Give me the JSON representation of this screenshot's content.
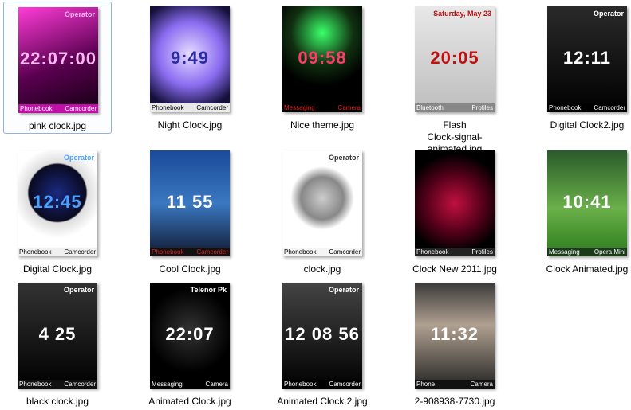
{
  "items": [
    {
      "label": "pink clock.jpg",
      "selected": true,
      "bg": "linear-gradient(160deg,#ff3cd8,#5a0050 55%,#120010)",
      "fg": "#ffb6f4",
      "op": "Operator",
      "time": "22:07:00",
      "left": "Phonebook",
      "right": "Camcorder",
      "keybg": "#c010a8"
    },
    {
      "label": "Night Clock.jpg",
      "bg": "radial-gradient(circle at 50% 45%,#e6dcff,#8a6cf0 45%,#14103a 80%)",
      "fg": "#2a2aa0",
      "op": "",
      "time": "9:49",
      "left": "Phonebook",
      "right": "Camcorder",
      "keybg": "#e8e8e8"
    },
    {
      "label": "Nice theme.jpg",
      "bg": "radial-gradient(circle at 50% 25%,#3cff6a,#103010 35%,#000 60%)",
      "fg": "#ff3c6a",
      "op": "",
      "time": "09:58",
      "left": "Messaging",
      "right": "Camera",
      "keybg": "#000",
      "keyfg": "#e02020"
    },
    {
      "label": "Flash\nClock-signal-animated.jpg",
      "bg": "linear-gradient(180deg,#e8e8e8,#bdbdbd)",
      "fg": "#c01010",
      "op": "Saturday, May 23",
      "time": "20:05",
      "left": "Bluetooth",
      "right": "Profiles",
      "keybg": "#888"
    },
    {
      "label": "Digital Clock2.jpg",
      "bg": "linear-gradient(180deg,#2a2a2a,#000)",
      "fg": "#fff",
      "op": "Operator",
      "time": "12:11",
      "left": "Phonebook",
      "right": "Camcorder",
      "keybg": "#000"
    },
    {
      "label": "Digital Clock.jpg",
      "bg": "radial-gradient(circle at 50% 40%,#1a2a80,#0a0a20 38%,#ddd 40%,#fff 60%)",
      "fg": "#4aa0ff",
      "op": "Operator",
      "time": "12:45",
      "left": "Phonebook",
      "right": "Camcorder",
      "keybg": "#f0f0f0"
    },
    {
      "label": "Cool Clock.jpg",
      "bg": "linear-gradient(180deg,#1a4a9a,#3a78c0 50%,#101830)",
      "fg": "#fff",
      "op": "",
      "time": "11 55",
      "left": "Phonebook",
      "right": "Camcorder",
      "keybg": "#111",
      "keyfg": "#e02020"
    },
    {
      "label": "clock.jpg",
      "bg": "radial-gradient(circle at 50% 45%,#ccc,#888 30%,#fff 45%)",
      "fg": "#333",
      "op": "Operator",
      "time": "",
      "left": "Phonebook",
      "right": "Camcorder",
      "keybg": "#f4f4f4"
    },
    {
      "label": "Clock New 2011.jpg",
      "bg": "radial-gradient(circle at 50% 50%,#c01040,#500018 45%,#000 75%)",
      "fg": "#fff",
      "op": "",
      "time": "",
      "left": "Phonebook",
      "right": "Profiles",
      "keybg": "#222"
    },
    {
      "label": "Clock Animated.jpg",
      "bg": "linear-gradient(180deg,#2a5a2a,#6ab04a 55%,#2a7a1a)",
      "fg": "#fff",
      "op": "",
      "time": "10:41",
      "left": "Messaging",
      "right": "Opera Mini",
      "keybg": "#1a3a1a"
    },
    {
      "label": "black clock.jpg",
      "bg": "linear-gradient(180deg,#333,#000)",
      "fg": "#fff",
      "op": "Operator",
      "time": "4 25",
      "left": "Phonebook",
      "right": "Camcorder",
      "keybg": "#111"
    },
    {
      "label": "Animated Clock.jpg",
      "bg": "radial-gradient(circle at 50% 45%,#333,#000 60%)",
      "fg": "#fff",
      "op": "Telenor Pk",
      "time": "22:07",
      "left": "Messaging",
      "right": "Camera",
      "keybg": "#000"
    },
    {
      "label": "Animated Clock 2.jpg",
      "bg": "linear-gradient(180deg,#444,#000)",
      "fg": "#fff",
      "op": "Operator",
      "time": "12 08 56",
      "left": "Phonebook",
      "right": "Camcorder",
      "keybg": "#000"
    },
    {
      "label": "2-908938-7730.jpg",
      "bg": "linear-gradient(180deg,#3a3a3a,#b0a090 40%,#222)",
      "fg": "#fff",
      "op": "",
      "time": "11:32",
      "left": "Phone",
      "right": "Camera",
      "keybg": "#111"
    }
  ]
}
